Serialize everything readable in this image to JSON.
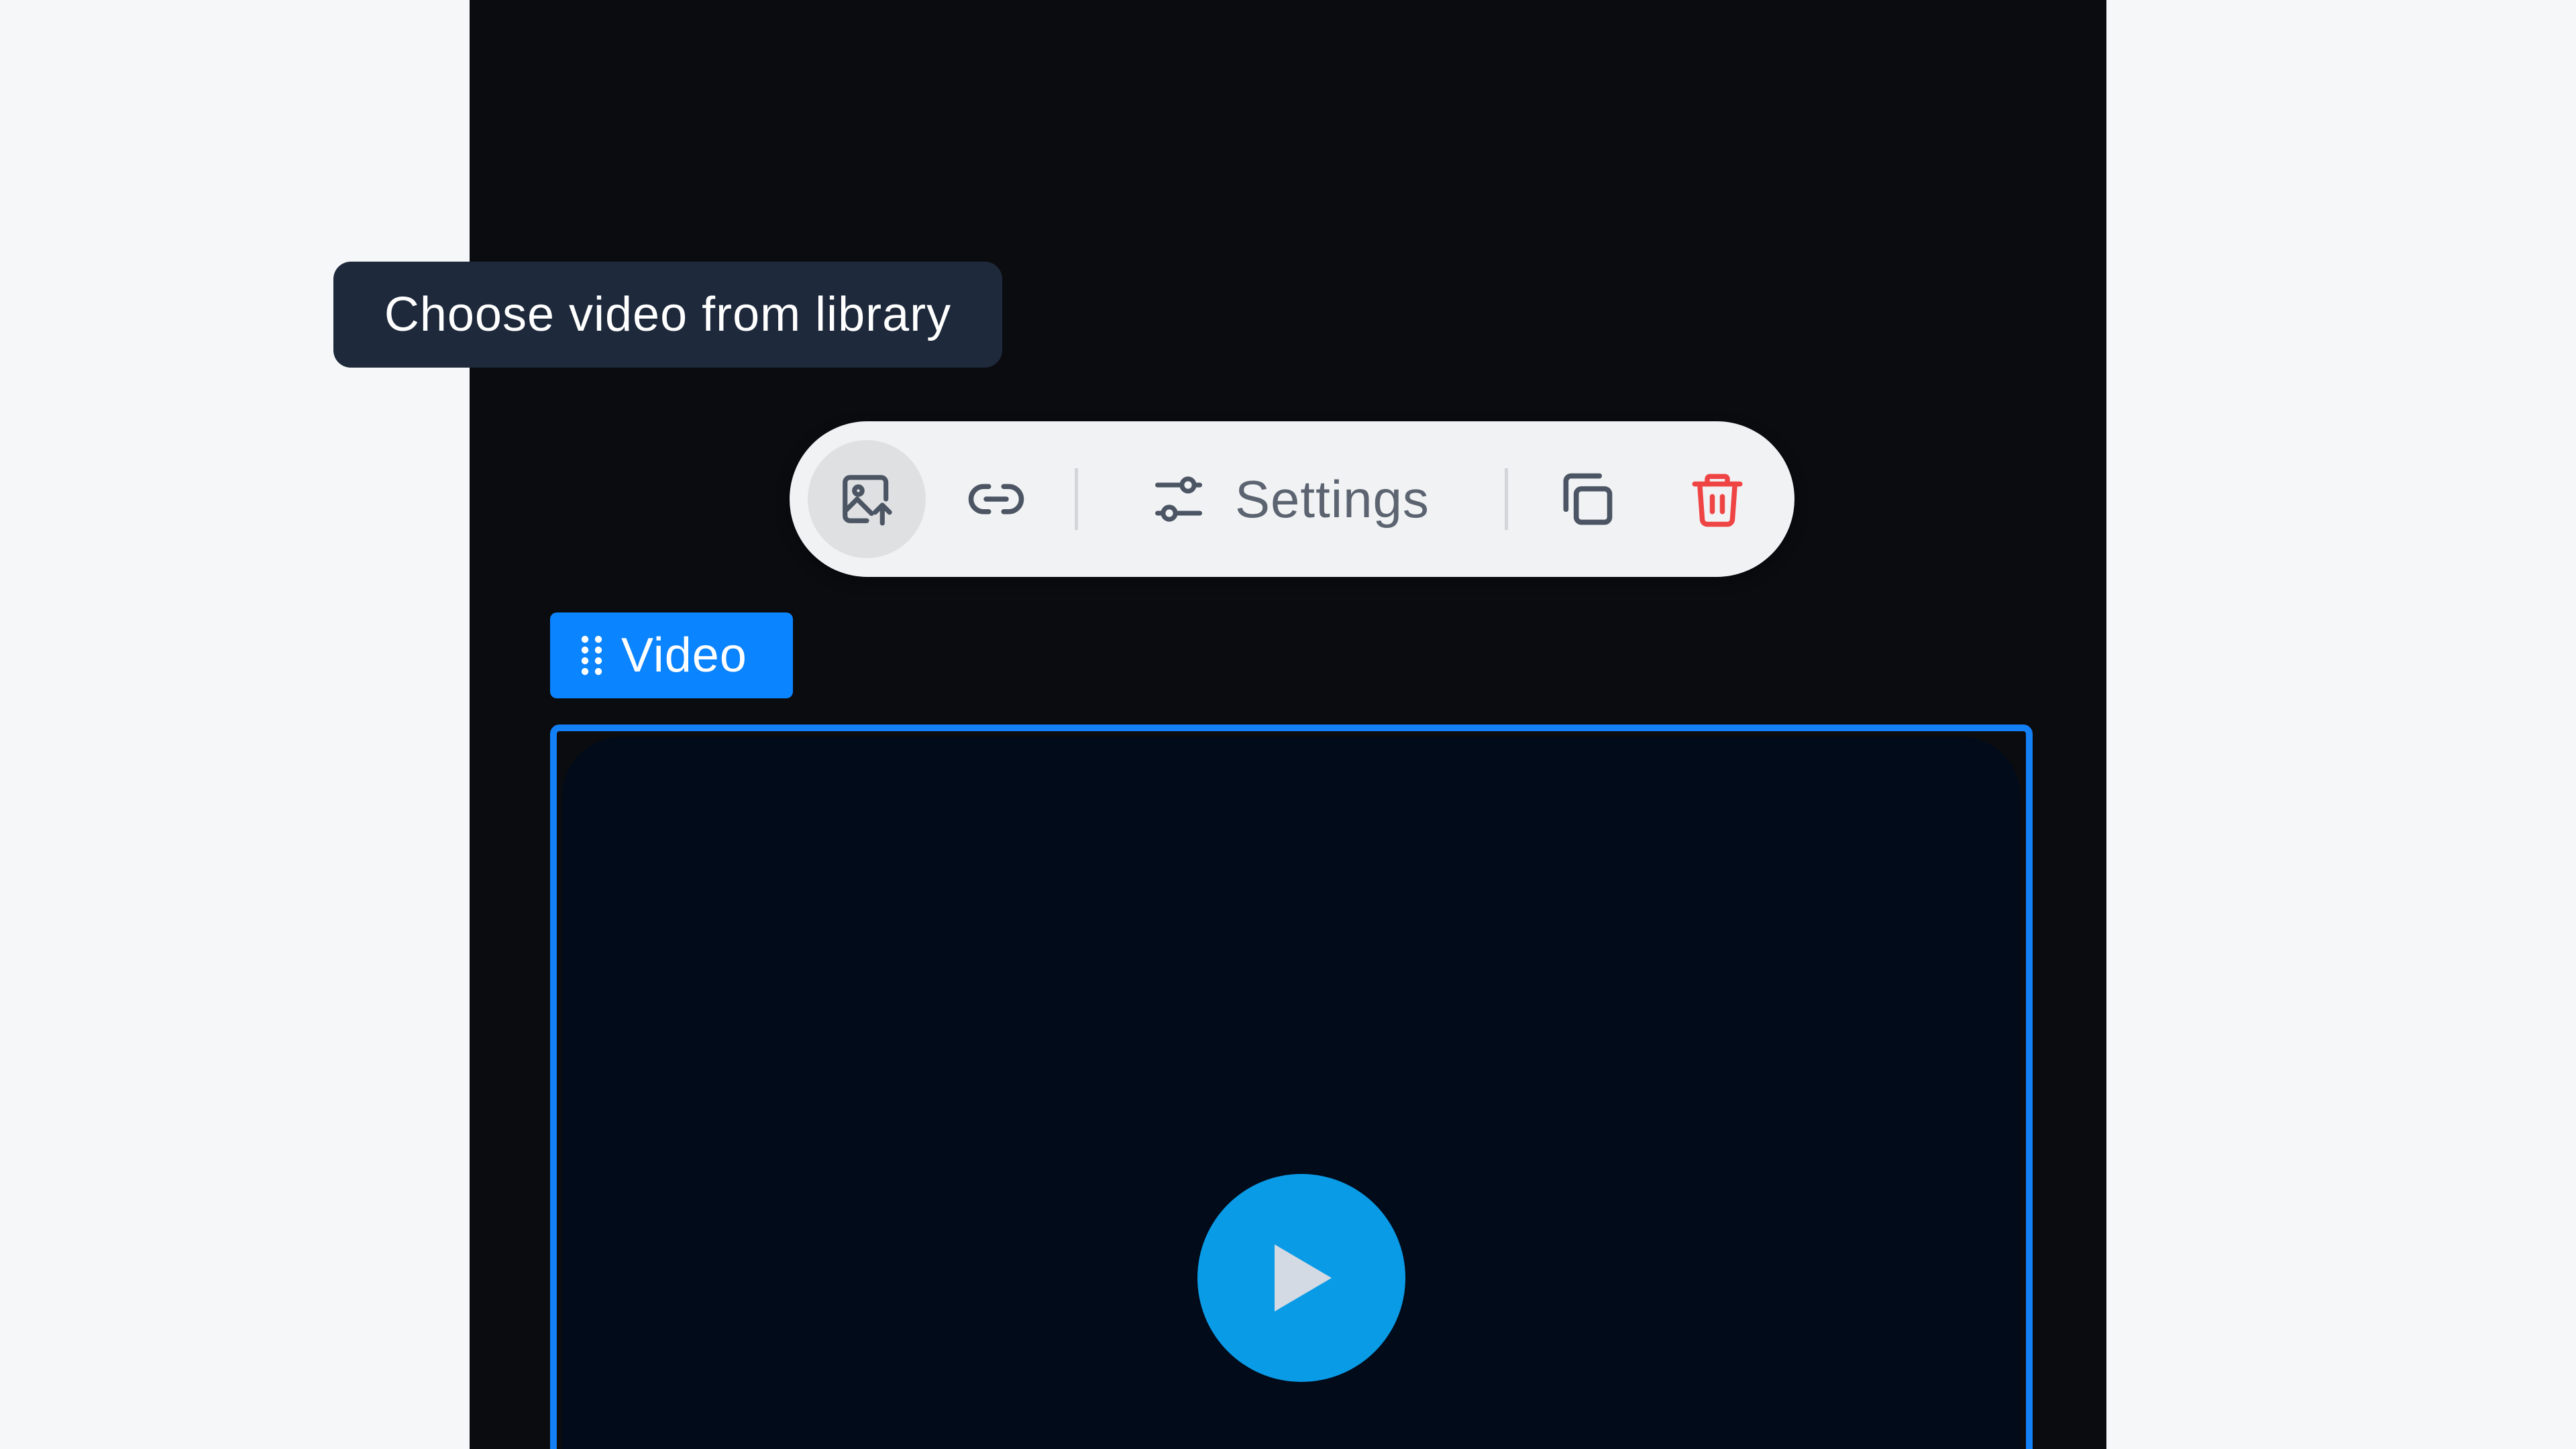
{
  "tooltip": {
    "text": "Choose video from library"
  },
  "toolbar": {
    "library_icon": "image-library-icon",
    "link_icon": "link-icon",
    "settings_icon": "sliders-icon",
    "settings_label": "Settings",
    "duplicate_icon": "copy-icon",
    "delete_icon": "trash-icon"
  },
  "block": {
    "label": "Video",
    "drag_icon": "drag-grip-icon"
  },
  "video": {
    "play_icon": "play-icon"
  },
  "colors": {
    "accent": "#0b84ff",
    "tooltip_bg": "#1e293b",
    "delete": "#ef4444",
    "play": "#0a9be6",
    "canvas": "#0b0c10",
    "page_bg": "#f6f7f9"
  }
}
